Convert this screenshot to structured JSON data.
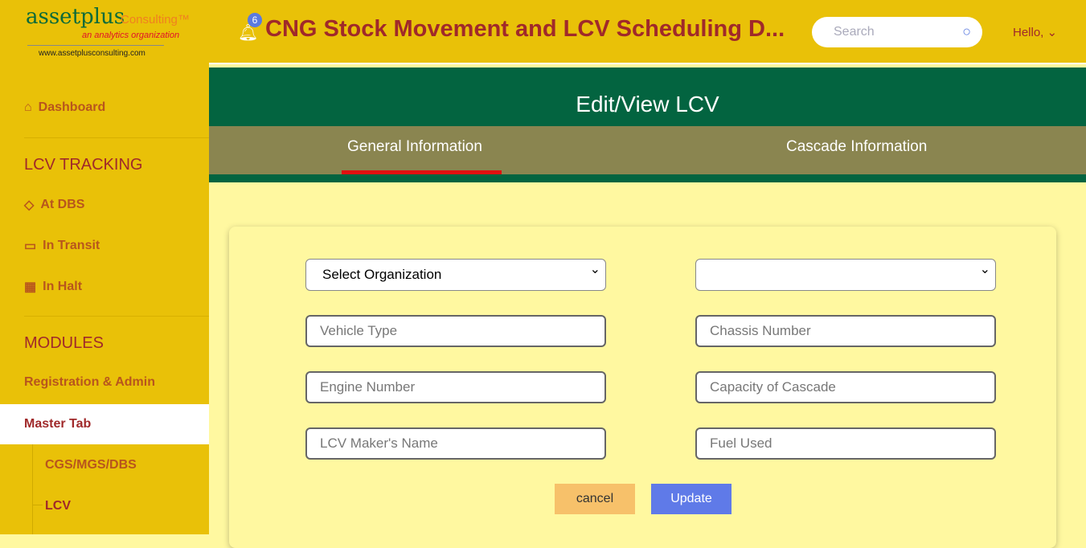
{
  "logo": {
    "brand": "assetplus",
    "consulting": "Consulting™",
    "tagline": "an analytics organization",
    "url": "www.assetplusconsulting.com"
  },
  "sidebar": {
    "dashboard": "Dashboard",
    "lcv_tracking": "LCV TRACKING",
    "at_dbs": "At DBS",
    "in_transit": "In Transit",
    "in_halt": "In Halt",
    "modules": "MODULES",
    "registration": "Registration & Admin",
    "master_tab": "Master Tab",
    "cgs": "CGS/MGS/DBS",
    "lcv": "LCV"
  },
  "header": {
    "title": "CNG Stock Movement and LCV Scheduling D...",
    "notifications": "6",
    "search_placeholder": "Search",
    "hello": "Hello,"
  },
  "page": {
    "title": "Edit/View LCV",
    "tabs": [
      "General Information",
      "Cascade Information"
    ],
    "active_tab": 0
  },
  "form": {
    "organization": "Select Organization",
    "second_select": "",
    "vehicle_type": "Vehicle Type",
    "chassis": "Chassis Number",
    "engine": "Engine Number",
    "capacity": "Capacity of Cascade",
    "maker": "LCV Maker's Name",
    "fuel": "Fuel Used",
    "cancel": "cancel",
    "update": "Update"
  }
}
